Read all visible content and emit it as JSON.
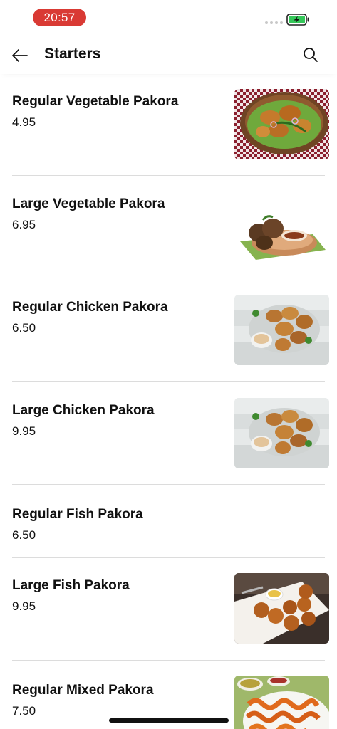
{
  "status_bar": {
    "time": "20:57",
    "time_pill_color": "#d93a34",
    "battery_icon": "battery-charging-icon",
    "battery_color": "#34c759"
  },
  "header": {
    "title": "Starters",
    "back_icon": "arrow-left-icon",
    "search_icon": "search-icon"
  },
  "items": [
    {
      "name": "Regular Vegetable Pakora",
      "price": "4.95",
      "image": "vegetable-pakora-basket"
    },
    {
      "name": "Large Vegetable Pakora",
      "price": "6.95",
      "image": "vegetable-pakora-plate"
    },
    {
      "name": "Regular Chicken Pakora",
      "price": "6.50",
      "image": "chicken-pakora"
    },
    {
      "name": "Large Chicken Pakora",
      "price": "9.95",
      "image": "chicken-pakora"
    },
    {
      "name": "Regular Fish Pakora",
      "price": "6.50",
      "image": ""
    },
    {
      "name": "Large Fish Pakora",
      "price": "9.95",
      "image": "fish-pakora"
    },
    {
      "name": "Regular Mixed Pakora",
      "price": "7.50",
      "image": "mixed-pakora"
    }
  ]
}
